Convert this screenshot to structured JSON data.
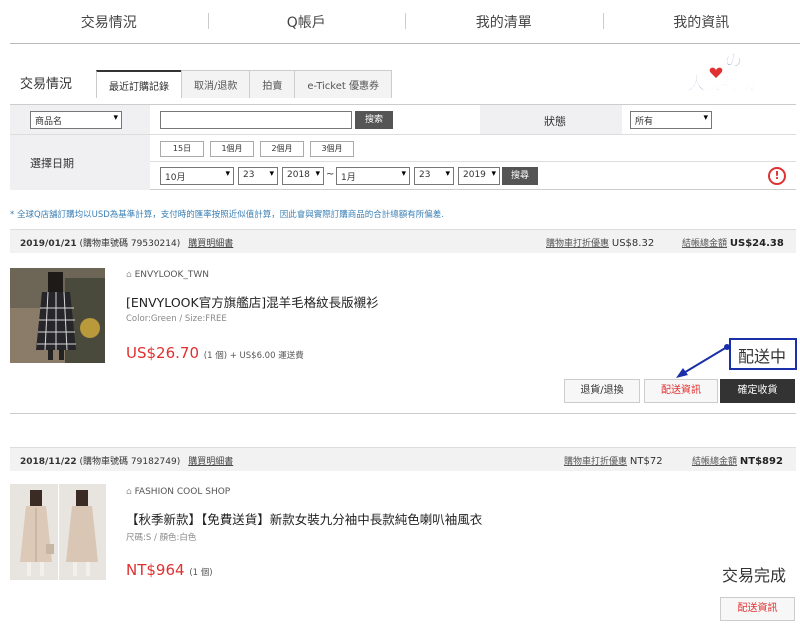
{
  "topnav": {
    "items": [
      "交易情況",
      "Q帳戶",
      "我的清單",
      "我的資訊"
    ]
  },
  "logo": {
    "line1": "婷婷醬の",
    "line2": "大玩特玩"
  },
  "section": {
    "title": "交易情況"
  },
  "tabs": [
    "最近訂購記錄",
    "取消/退款",
    "拍賣",
    "e-Ticket 優惠券"
  ],
  "filter": {
    "field_select": "商品名",
    "search_value": "",
    "search_btn": "搜索",
    "status_label": "狀態",
    "status_select": "所有",
    "date_label": "選擇日期",
    "quick_ranges": [
      "15日",
      "1個月",
      "2個月",
      "3個月"
    ],
    "from_month": "10月",
    "from_day": "23",
    "from_year": "2018",
    "tilde": "~",
    "to_month": "1月",
    "to_day": "23",
    "to_year": "2019",
    "search2_btn": "搜尋",
    "alert_icon": "!"
  },
  "note": "* 全球Q店舖訂購均以USD為基準計算，支付時的匯率按照近似值計算，因此會與實際訂購商品的合計總額有所偏差.",
  "orders": [
    {
      "date": "2019/01/21",
      "cart_no": "(購物車號碼 79530214)",
      "detail_link": "購買明細書",
      "discount_label": "購物車打折優惠",
      "discount_value": "US$8.32",
      "total_label": "結帳總金額",
      "total_value": "US$24.38",
      "shop": "ENVYLOOK_TWN",
      "name": "[ENVYLOOK官方旗艦店]混羊毛格紋長版襯衫",
      "option": "Color:Green / Size:FREE",
      "price": "US$26.70",
      "qty": "(1 個) + US$6.00 運送費",
      "status": "配送中",
      "buttons": [
        "退貨/退換",
        "配送資訊",
        "確定收貨"
      ]
    },
    {
      "date": "2018/11/22",
      "cart_no": "(購物車號碼 79182749)",
      "detail_link": "購買明細書",
      "discount_label": "購物車打折優惠",
      "discount_value": "NT$72",
      "total_label": "結帳總金額",
      "total_value": "NT$892",
      "shop": "FASHION COOL SHOP",
      "name": "【秋季新款】【免費送貨】新款女裝九分袖中長款純色喇叭袖風衣",
      "option": "尺碼:S / 顏色:白色",
      "price": "NT$964",
      "qty": "(1 個)",
      "status": "交易完成",
      "buttons": [
        "配送資訊"
      ]
    }
  ],
  "colors": {
    "accent_red": "#e03030",
    "annotation_blue": "#1a2fa8",
    "link_blue": "#3a7fb5"
  }
}
